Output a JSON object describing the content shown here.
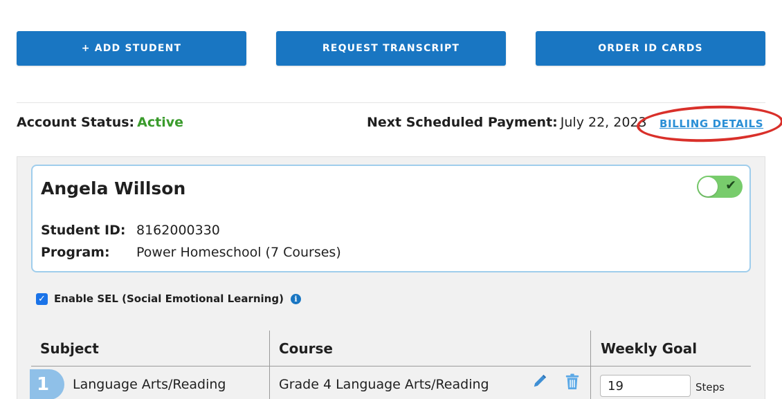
{
  "toolbar": {
    "add_student": "+ ADD STUDENT",
    "request_transcript": "REQUEST TRANSCRIPT",
    "order_id_cards": "ORDER ID CARDS"
  },
  "account": {
    "status_label": "Account Status:",
    "status_value": "Active",
    "next_payment_label": "Next Scheduled Payment:",
    "next_payment_value": "July 22, 2023",
    "billing_link": "BILLING DETAILS"
  },
  "student": {
    "name": "Angela Willson",
    "id_label": "Student ID:",
    "id_value": "8162000330",
    "program_label": "Program:",
    "program_value": "Power Homeschool (7 Courses)",
    "active_toggle": true
  },
  "sel": {
    "label": "Enable SEL (Social Emotional Learning)",
    "checked": true
  },
  "table": {
    "headers": [
      "Subject",
      "Course",
      "Weekly Goal"
    ],
    "rows": [
      {
        "number": "1",
        "subject": "Language Arts/Reading",
        "course": "Grade 4 Language Arts/Reading",
        "weekly_goal": "19",
        "unit": "Steps"
      }
    ]
  },
  "colors": {
    "primary": "#1976c2",
    "active": "#3a9b2c",
    "link": "#2a8fd6",
    "annotation": "#d9302a",
    "toggle_on": "#78cc6c"
  },
  "icons": [
    "check-icon",
    "info-icon",
    "pencil-icon",
    "trash-icon"
  ]
}
